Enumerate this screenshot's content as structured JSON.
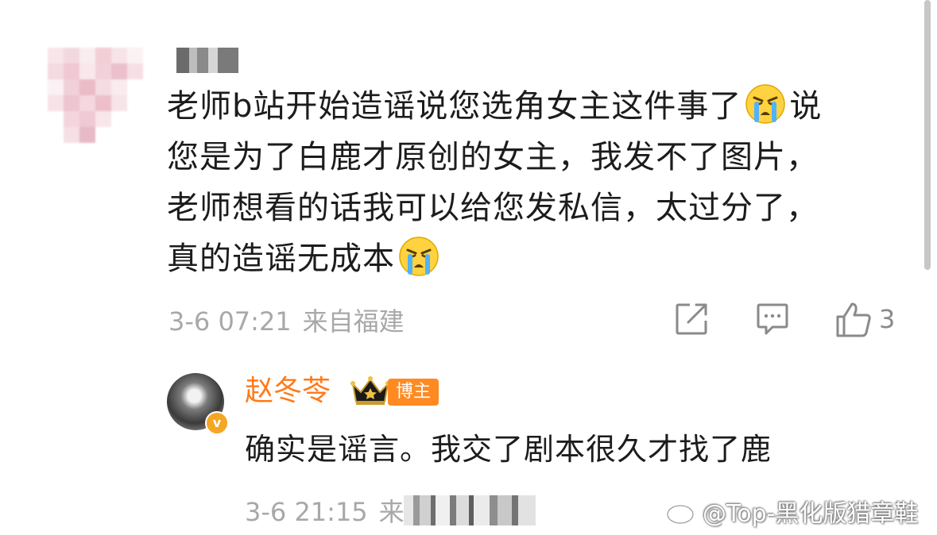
{
  "comment": {
    "lines": [
      "老师b站开始造谣说您选角女主这件事了",
      "说",
      "您是为了白鹿才原创的女主，我发不了图片，",
      "老师想看的话我可以给您发私信，太过分了，",
      "真的造谣无成本"
    ],
    "emoji": "crying-face",
    "date": "3-6 07:21",
    "location": "来自福建",
    "like_count": "3"
  },
  "reply": {
    "author": "赵冬苓",
    "role_badge": "博主",
    "verified_mark": "v",
    "text": "确实是谣言。我交了剧本很久才找了鹿",
    "date": "3-6 21:15",
    "location_prefix": "来"
  },
  "watermark": {
    "text": "@Top-黑化版猎章鞋"
  },
  "colors": {
    "text": "#1c1c1c",
    "meta": "#a8a8a8",
    "author": "#ff7a1a",
    "badge": "#ff8a22",
    "verified": "#f5a623"
  }
}
